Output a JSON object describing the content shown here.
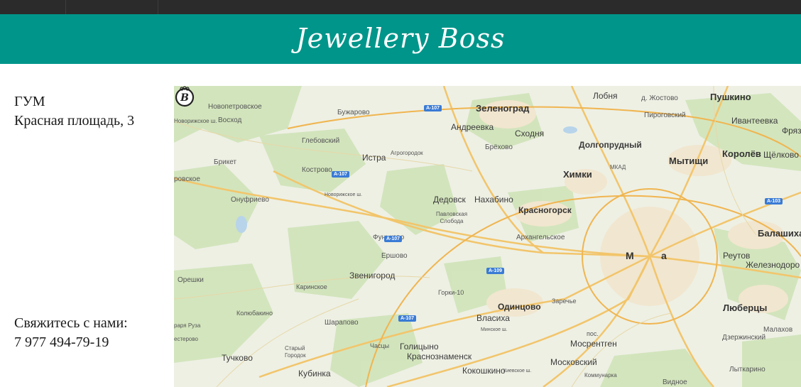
{
  "header": {
    "brand": "Jewellery Boss",
    "background": "#00958a"
  },
  "store": {
    "name": "ГУМ",
    "address": "Красная площадь, 3"
  },
  "contact": {
    "label": "Свяжитесь с нами:",
    "phone": "7 977 494-79-19"
  },
  "map": {
    "marker_letter": "B",
    "marker_left": "М",
    "marker_right": "а",
    "labels": [
      "Новопетровское",
      "Бужарово",
      "Зеленоград",
      "Лобня",
      "д. Жостово",
      "Пушкино",
      "Новорижское ш.",
      "Восход",
      "Андреевка",
      "Сходня",
      "Пироговский",
      "Ивантеевка",
      "Фряз",
      "Глебовский",
      "Брёхово",
      "Долгопрудный",
      "Истра",
      "Агрогородок",
      "Брикет",
      "Кострово",
      "Химки",
      "МКАД",
      "Мытищи",
      "Королёв",
      "Щёлково",
      "ровское",
      "Онуфриево",
      "Дедовск",
      "Нахабино",
      "Красногорск",
      "Павловская Слобода",
      "Балашиха",
      "Фуньково",
      "Ершово",
      "Архангельское",
      "Реутов",
      "Железнодоро",
      "Звенигород",
      "Орешки",
      "Каринское",
      "Горки-10",
      "Одинцово",
      "Заречье",
      "Люберцы",
      "Колюбакино",
      "Шарапово",
      "Власиха",
      "раря Руза",
      "Малахов",
      "естерово",
      "Часцы",
      "Голицыно",
      "Краснознаменск",
      "Мосрентген",
      "Дзержинский",
      "пос.",
      "Тучково",
      "Старый Городок",
      "Кокошкино",
      "Московский",
      "Лыткарино",
      "Кубинка",
      "Коммунарка",
      "Видное",
      "Минское ш.",
      "Киевское ш.",
      "Новорижское ш."
    ],
    "shields": [
      "A-107",
      "A-107",
      "A-107",
      "A-109",
      "A-107",
      "A-103"
    ]
  }
}
